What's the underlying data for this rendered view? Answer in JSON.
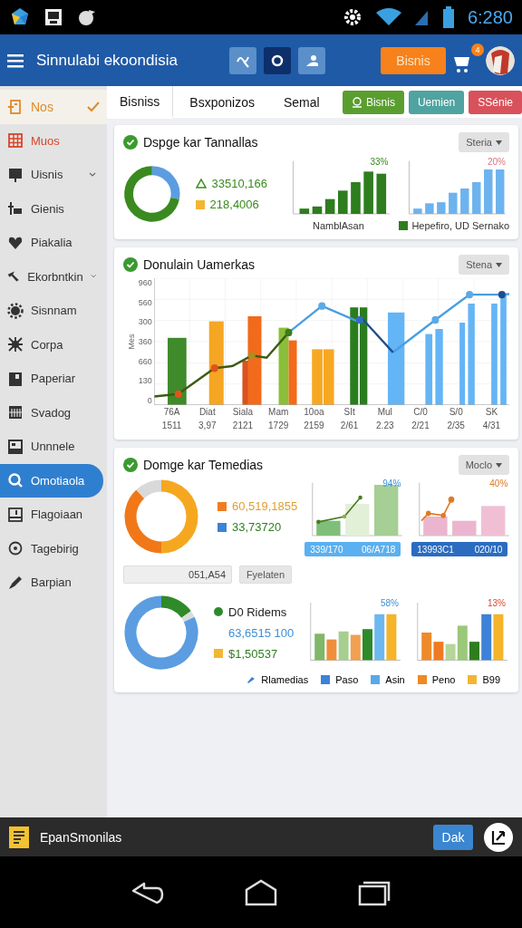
{
  "status_bar": {
    "time": "6:280"
  },
  "app_bar": {
    "title": "Sinnulabi ekoondisia",
    "tools": [
      {
        "selected": false
      },
      {
        "selected": true
      },
      {
        "selected": false
      }
    ],
    "action_button": "Bisnis",
    "cart_badge": "4"
  },
  "sidebar": {
    "items": [
      {
        "label": "Nos",
        "kind": "header",
        "selected": false,
        "color": "#e08a2a"
      },
      {
        "label": "Muos",
        "kind": "link",
        "selected": false,
        "color": "#d9452b"
      },
      {
        "label": "Uisnis",
        "kind": "group",
        "selected": false,
        "color": "#333333"
      },
      {
        "label": "Gienis",
        "kind": "link",
        "selected": false,
        "color": "#333333"
      },
      {
        "label": "Piakalia",
        "kind": "link",
        "selected": false,
        "color": "#333333"
      },
      {
        "label": "Ekorbntkin",
        "kind": "group",
        "selected": false,
        "color": "#333333"
      },
      {
        "label": "Sisnnam",
        "kind": "link",
        "selected": false,
        "color": "#333333"
      },
      {
        "label": "Corpa",
        "kind": "link",
        "selected": false,
        "color": "#333333"
      },
      {
        "label": "Paperiar",
        "kind": "link",
        "selected": false,
        "color": "#333333"
      },
      {
        "label": "Svadog",
        "kind": "link",
        "selected": false,
        "color": "#333333"
      },
      {
        "label": "Unnnele",
        "kind": "link",
        "selected": false,
        "color": "#333333"
      },
      {
        "label": "Omotiaola",
        "kind": "link",
        "selected": true,
        "color": "#ffffff"
      },
      {
        "label": "Flagoiaan",
        "kind": "link",
        "selected": false,
        "color": "#333333"
      },
      {
        "label": "Tagebirig",
        "kind": "link",
        "selected": false,
        "color": "#333333"
      },
      {
        "label": "Barpian",
        "kind": "link",
        "selected": false,
        "color": "#333333"
      }
    ]
  },
  "tabs": [
    {
      "label": "Bisniss",
      "selected": true
    },
    {
      "label": "Bsxponizos",
      "selected": false
    },
    {
      "label": "Semal",
      "selected": false
    }
  ],
  "chips": [
    {
      "label": "Bisnis",
      "color": "#5a9e2f"
    },
    {
      "label": "Uemien",
      "color": "#4fa3a0"
    },
    {
      "label": "SSénie",
      "color": "#d9515a"
    }
  ],
  "summary_card": {
    "title": "Dspge kar Tannallas",
    "dropdown": "Steria",
    "legend": [
      {
        "kind": "triangle",
        "value": "33510,166"
      },
      {
        "kind": "square",
        "value": "218,4006",
        "color": "#f2b632"
      }
    ],
    "chart_a": {
      "label": "33%",
      "caption": "NamblAsan"
    },
    "chart_b": {
      "label": "20%",
      "legend": "Hepefiro, UD Sernako"
    }
  },
  "trend_card": {
    "title": "Donulain Uamerkas",
    "dropdown": "Stena",
    "ylabel": "Mes",
    "yticks": [
      "960",
      "560",
      "300",
      "360",
      "660",
      "130",
      "0"
    ],
    "categories": [
      {
        "name": "76A",
        "value": "1511"
      },
      {
        "name": "Diat",
        "value": "3,97"
      },
      {
        "name": "Siala",
        "value": "2121"
      },
      {
        "name": "Mam",
        "value": "1729"
      },
      {
        "name": "10oa",
        "value": "2159"
      },
      {
        "name": "SIt",
        "value": "2/61"
      },
      {
        "name": "Mul",
        "value": "2.23"
      },
      {
        "name": "C/0",
        "value": "2/21"
      },
      {
        "name": "S/0",
        "value": "2/35"
      },
      {
        "name": "SK",
        "value": "4/31"
      }
    ]
  },
  "detail_card": {
    "title": "Domge kar Temedias",
    "dropdown": "Moclo",
    "legend_top": [
      {
        "kind": "square",
        "value": "60,519,1855",
        "color": "#ee7d22"
      },
      {
        "kind": "square",
        "value": "33,73720",
        "color": "#3d82d6"
      }
    ],
    "field_value": "051,A54",
    "button": "Fyelaten",
    "chart_a": {
      "label": "94%",
      "footer": [
        "339/170",
        "06/A718"
      ]
    },
    "chart_b": {
      "label": "40%",
      "footer": [
        "13993C1",
        "020/10"
      ]
    },
    "legend_bottom": [
      {
        "kind": "dot",
        "value": "D0 Ridems",
        "color": "#2f8a2a"
      },
      {
        "kind": "plain",
        "value": "63,6515 100"
      },
      {
        "kind": "square",
        "value": "$1,50537",
        "color": "#f2b632"
      }
    ],
    "chart_c": {
      "label": "58%"
    },
    "chart_d": {
      "label": "13%"
    },
    "series": [
      {
        "name": "Rlamedias",
        "color": "#3d82d6",
        "kind": "pin"
      },
      {
        "name": "Paso",
        "color": "#3d82d6",
        "kind": "square"
      },
      {
        "name": "Asin",
        "color": "#5aa8e8",
        "kind": "square"
      },
      {
        "name": "Peno",
        "color": "#ee8a22",
        "kind": "square"
      },
      {
        "name": "B99",
        "color": "#f2b632",
        "kind": "square"
      }
    ]
  },
  "bottom_bar": {
    "title": "EpanSmonilas",
    "button": "Dak"
  }
}
